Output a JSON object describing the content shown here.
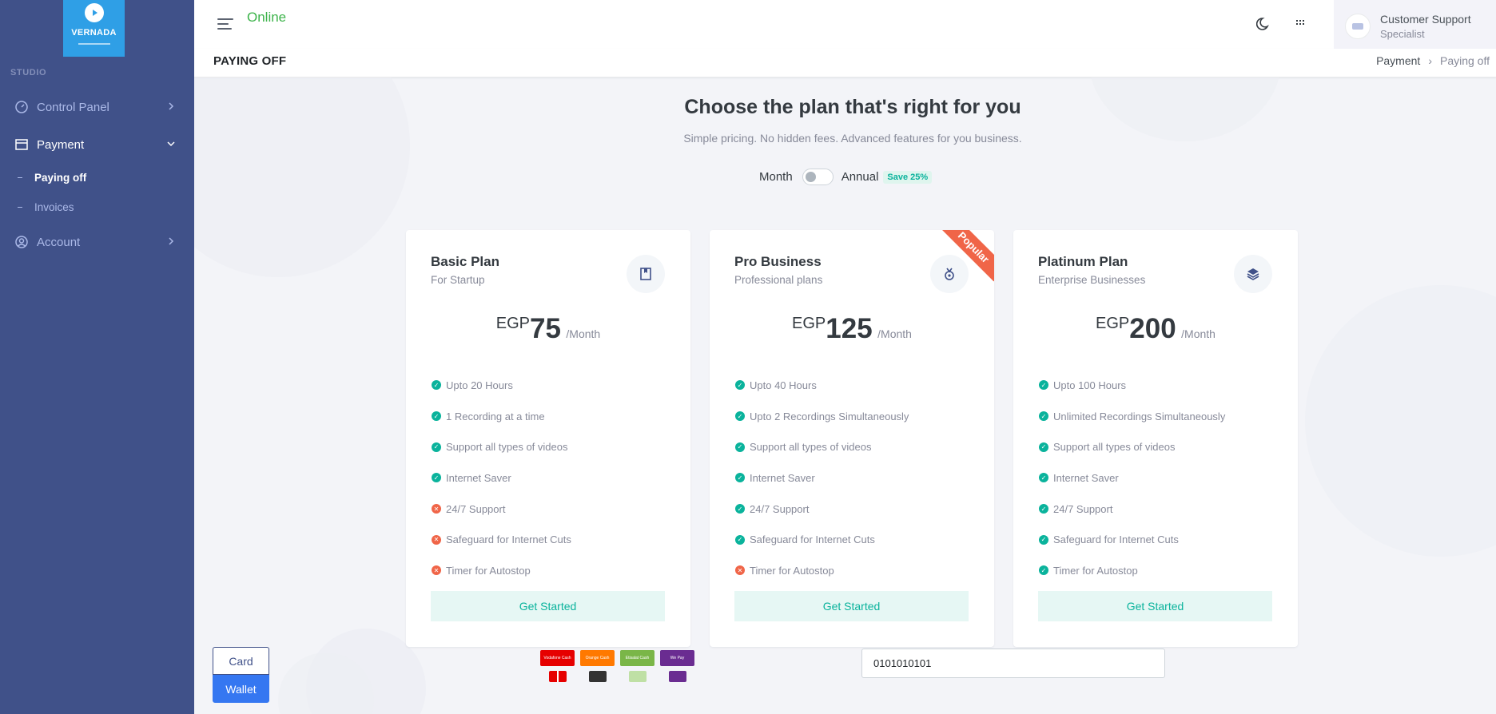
{
  "sidebar": {
    "logo_text": "VERNADA",
    "menu_title": "STUDIO",
    "items": [
      {
        "label": "Control Panel",
        "icon": "dashboard-icon"
      },
      {
        "label": "Payment",
        "icon": "payment-icon"
      },
      {
        "label": "Account",
        "icon": "account-icon"
      }
    ],
    "payment_subitems": [
      {
        "label": "Paying off"
      },
      {
        "label": "Invoices"
      }
    ]
  },
  "topbar": {
    "status": "Online",
    "user_name": "Customer Support",
    "user_role": "Specialist"
  },
  "page": {
    "title": "PAYING OFF",
    "breadcrumb": [
      "Payment",
      "Paying off"
    ]
  },
  "pricing": {
    "heading": "Choose the plan that's right for you",
    "subheading": "Simple pricing. No hidden fees. Advanced features for you business.",
    "toggle_left": "Month",
    "toggle_right": "Annual",
    "save_badge": "Save 25%",
    "ribbon": "Popular",
    "plans": [
      {
        "name": "Basic Plan",
        "sub": "For Startup",
        "currency": "EGP",
        "price": "75",
        "period": "/Month",
        "button": "Get Started",
        "features": [
          {
            "b": "",
            "t": "Upto",
            "bold": "20",
            "rest": "Hours",
            "ok": true
          },
          {
            "pre": "",
            "bold": "1",
            "rest": "Recording at a time",
            "ok": true
          },
          {
            "pre": "",
            "bold": "",
            "rest": "Support all types of videos",
            "ok": true
          },
          {
            "pre": "",
            "bold": "",
            "rest": "Internet Saver",
            "ok": true
          },
          {
            "pre": "",
            "bold": "24/7",
            "rest": "Support",
            "ok": false
          },
          {
            "pre": "",
            "bold": "",
            "rest": "Safeguard for Internet Cuts",
            "ok": false
          },
          {
            "pre": "",
            "bold": "",
            "rest": "Timer for Autostop",
            "ok": false
          }
        ]
      },
      {
        "name": "Pro Business",
        "sub": "Professional plans",
        "currency": "EGP",
        "price": "125",
        "period": "/Month",
        "button": "Get Started"
      },
      {
        "name": "Platinum Plan",
        "sub": "Enterprise Businesses",
        "currency": "EGP",
        "price": "200",
        "period": "/Month",
        "button": "Get Started"
      }
    ],
    "features_text": {
      "basic": [
        "Upto 20 Hours",
        "1 Recording at a time",
        "Support all types of videos",
        "Internet Saver",
        "24/7 Support",
        "Safeguard for Internet Cuts",
        "Timer for Autostop"
      ],
      "pro": [
        "Upto 40 Hours",
        "Upto 2 Recordings Simultaneously",
        "Support all types of videos",
        "Internet Saver",
        "24/7 Support",
        "Safeguard for Internet Cuts",
        "Timer for Autostop"
      ],
      "platinum": [
        "Upto 100 Hours",
        "Unlimited Recordings Simultaneously",
        "Support all types of videos",
        "Internet Saver",
        "24/7 Support",
        "Safeguard for Internet Cuts",
        "Timer for Autostop"
      ]
    }
  },
  "payment": {
    "tab_card": "Card",
    "tab_wallet": "Wallet",
    "wallet_labels": [
      "Vodafone Cash",
      "Orange Cash",
      "Etisalat Cash",
      "We Pay"
    ],
    "wallet_colors": [
      "#e60000",
      "#ff7900",
      "#7ab648",
      "#6a2c91"
    ],
    "phone_value": "0101010101"
  }
}
